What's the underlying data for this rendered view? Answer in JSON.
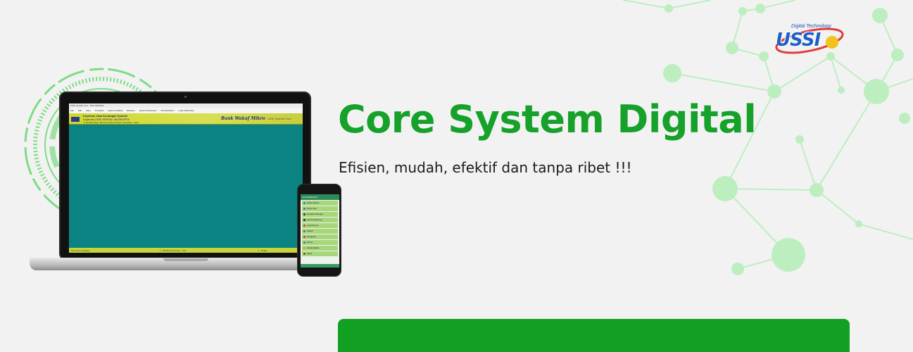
{
  "brand": {
    "logo_text": "USSI",
    "logo_tagline": "Digital Technology",
    "logo_colors": {
      "primary": "#1f5fc7",
      "accent": "#e23c3c"
    }
  },
  "hero": {
    "title": "Core System Digital",
    "subtitle": "Efisien, mudah, efektif dan tanpa ribet !!!"
  },
  "laptop_app": {
    "window_title": "USSI Syariah Core - BUS MIRADIA",
    "menu": [
      "File",
      "Edit",
      "View",
      "Transaksi",
      "System Aplikasi",
      "Bantuan",
      "System Parameter",
      "Administration",
      "Login Parameter"
    ],
    "banner": {
      "line1": "Koperasi Jasa Keuangan Syariah",
      "line2": "Koperasi USSI SERVAL MUSHOFFA",
      "line3": "Jl. Mutiara Raya, Taman Hanang Pratama, Bengkulu, Jawa",
      "product": "Bank Wakaf Mikro",
      "product_sub": "USSI Syariah Core"
    },
    "status": [
      "Kas Utama (Ready)",
      "BOOK Kas Khusus - 001",
      "Ready"
    ]
  },
  "phone_app": {
    "header": "Core Dashboard",
    "items": [
      "Mobile Kolektor",
      "Mobile Teller",
      "Penarikan Tabungan",
      "Informasi Rekening",
      "Cetak Resume",
      "Aktivasi",
      "Pengaturan",
      "Sinkron",
      "Update Aplikasi",
      "Keluar"
    ]
  },
  "cta": {
    "color": "#12a023"
  },
  "accent_colors": {
    "headline": "#16a12a",
    "network": "#8ee08f"
  }
}
